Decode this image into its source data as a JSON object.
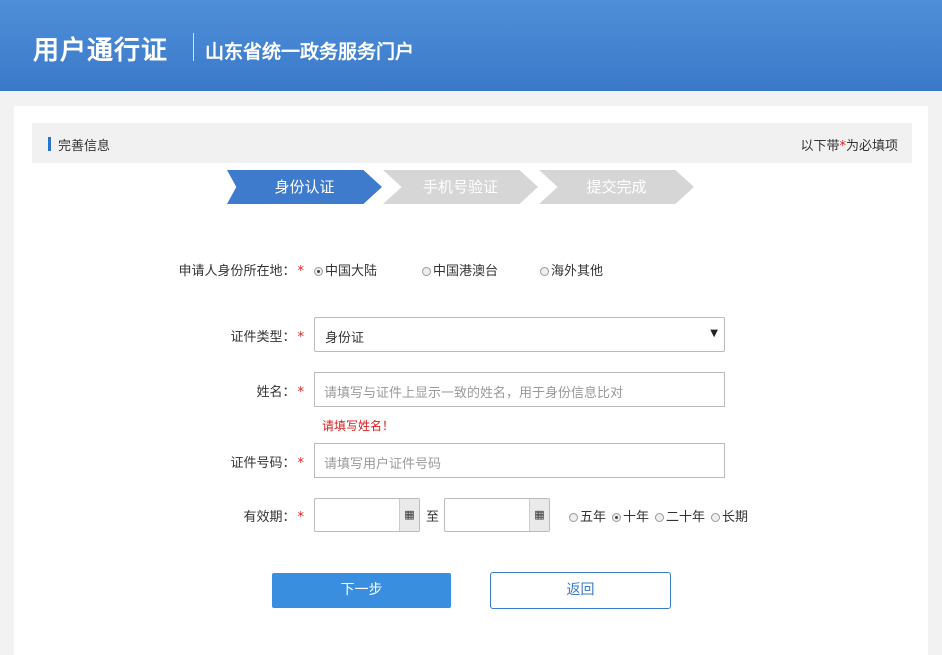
{
  "header": {
    "title": "用户通行证",
    "subtitle": "山东省统一政务服务门户"
  },
  "section": {
    "label": "完善信息",
    "note_prefix": "以下带",
    "note_star": "*",
    "note_suffix": "为必填项"
  },
  "steps": [
    "身份认证",
    "手机号验证",
    "提交完成"
  ],
  "form": {
    "location": {
      "label": "申请人身份所在地：",
      "options": [
        "中国大陆",
        "中国港澳台",
        "海外其他"
      ],
      "selected": "中国大陆"
    },
    "id_type": {
      "label": "证件类型：",
      "value": "身份证"
    },
    "name": {
      "label": "姓名：",
      "placeholder": "请填写与证件上显示一致的姓名，用于身份信息比对",
      "error": "请填写姓名！"
    },
    "id_number": {
      "label": "证件号码：",
      "placeholder": "请填写用户证件号码"
    },
    "validity": {
      "label": "有效期：",
      "to": "至",
      "options": [
        "五年",
        "十年",
        "二十年",
        "长期"
      ],
      "selected": "十年"
    },
    "required_mark": "*"
  },
  "buttons": {
    "next": "下一步",
    "back": "返回"
  },
  "colors": {
    "header": "#3a79c8",
    "active_step": "#3f7bcc",
    "inactive_step": "#d6d6d6",
    "required": "#e02020",
    "primary_button": "#3a8ee0"
  }
}
